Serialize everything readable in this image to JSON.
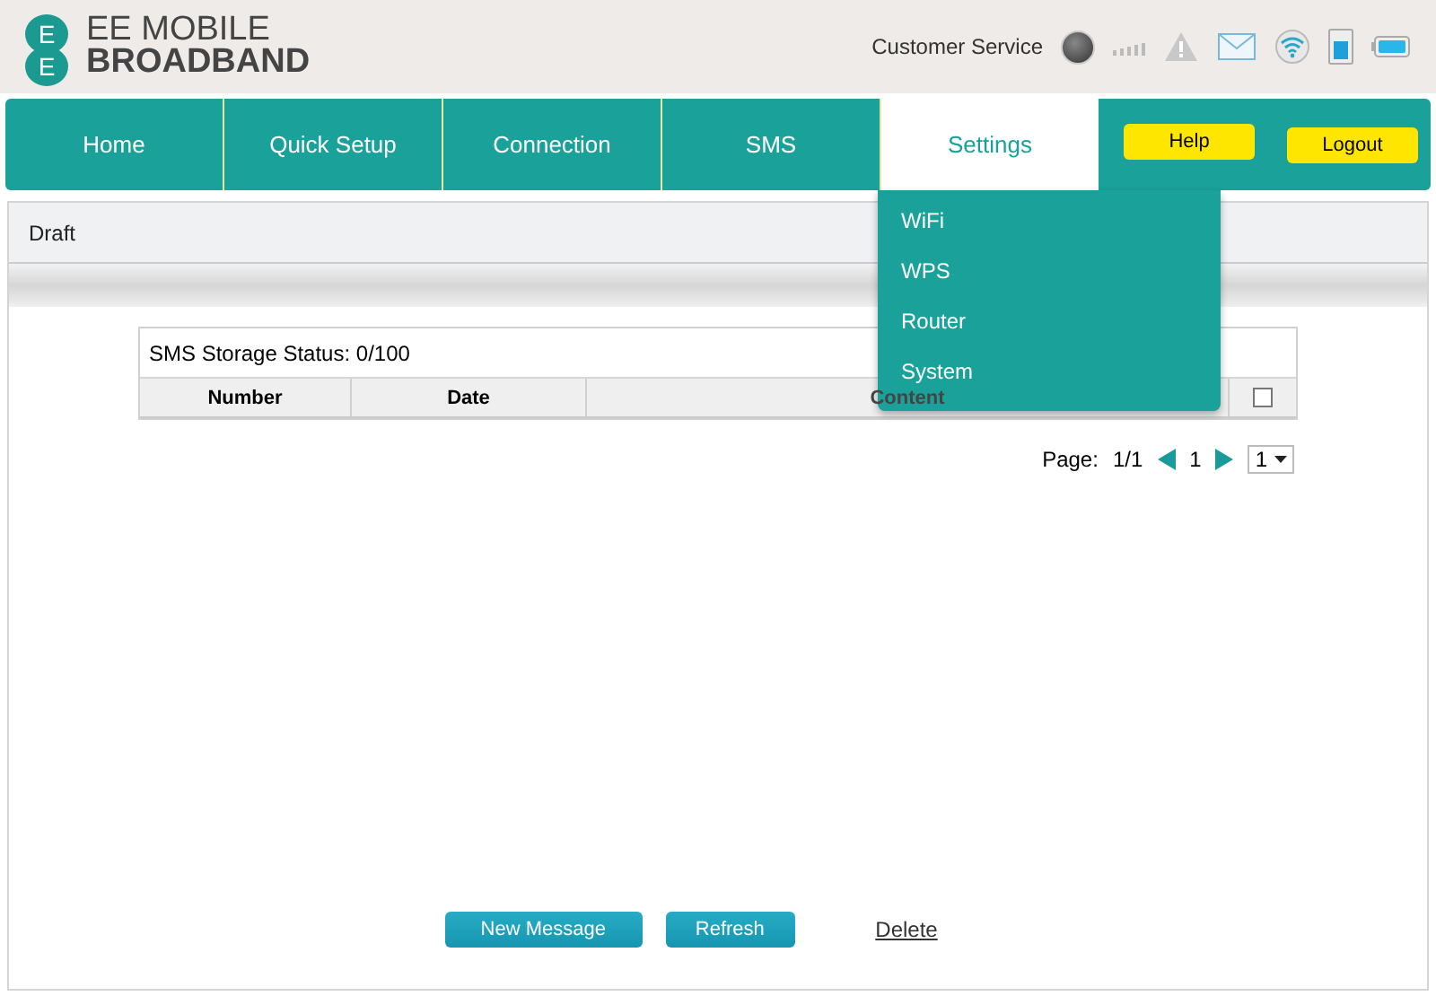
{
  "header": {
    "logo_letters": [
      "E",
      "E"
    ],
    "brand_line_1": "EE MOBILE",
    "brand_line_2": "BROADBAND",
    "customer_service": "Customer Service"
  },
  "nav": {
    "tabs": [
      {
        "label": "Home",
        "selected": false
      },
      {
        "label": "Quick Setup",
        "selected": false
      },
      {
        "label": "Connection",
        "selected": false
      },
      {
        "label": "SMS",
        "selected": false
      },
      {
        "label": "Settings",
        "selected": true
      }
    ],
    "buttons": [
      "Help",
      "Logout"
    ],
    "dropdown": [
      "WiFi",
      "WPS",
      "Router",
      "System"
    ]
  },
  "panel": {
    "title": "Draft"
  },
  "table": {
    "storage_status": "SMS Storage Status: 0/100",
    "columns": [
      "Number",
      "Date",
      "Content"
    ],
    "select_all": {
      "checked": false
    }
  },
  "pagination": {
    "label": "Page:",
    "pages": "1/1",
    "current": "1",
    "page_select": "1"
  },
  "actions": {
    "buttons": [
      "New Message",
      "Refresh"
    ],
    "link": "Delete"
  }
}
